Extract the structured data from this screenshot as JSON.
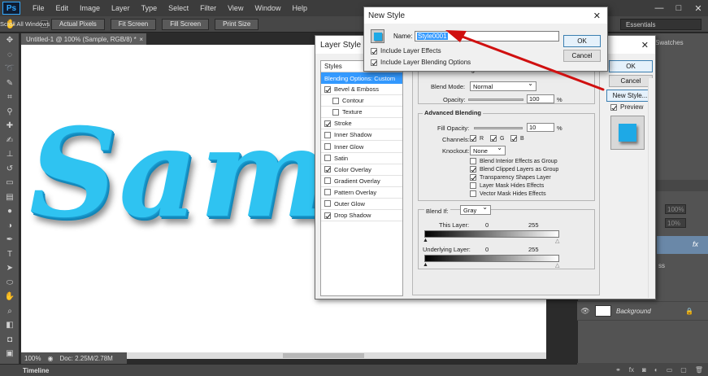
{
  "app": {
    "logo": "Ps"
  },
  "menu": [
    "File",
    "Edit",
    "Image",
    "Layer",
    "Type",
    "Select",
    "Filter",
    "View",
    "Window",
    "Help"
  ],
  "window_controls": {
    "minimize": "—",
    "maximize": "□",
    "close": "✕"
  },
  "options_bar": {
    "tool_icon": "hand-icon",
    "scroll_all_label": "Scroll All Windows",
    "buttons": [
      "Actual Pixels",
      "Fit Screen",
      "Fill Screen",
      "Print Size"
    ],
    "workspace": "Essentials"
  },
  "document": {
    "tab_title": "Untitled-1 @ 100% (Sample, RGB/8) *",
    "tab_close": "×",
    "canvas_text": "Sam",
    "text_color": "#2fc3f1"
  },
  "status": {
    "zoom": "100%",
    "doc_size": "Doc: 2.25M/2.78M"
  },
  "timeline": {
    "label": "Timeline"
  },
  "panels": {
    "swatches_tab": "Swatches",
    "opacity_pct": "100%",
    "fill_pct": "10%",
    "fx_label": "fx",
    "ss_text": "ss",
    "background_layer": "Background"
  },
  "layer_style": {
    "title": "Layer Style",
    "close": "✕",
    "styles_header": "Styles",
    "blending_item": "Blending Options: Custom",
    "items": [
      {
        "label": "Bevel & Emboss",
        "checked": true,
        "sub": false
      },
      {
        "label": "Contour",
        "checked": false,
        "sub": true
      },
      {
        "label": "Texture",
        "checked": false,
        "sub": true
      },
      {
        "label": "Stroke",
        "checked": true,
        "sub": false
      },
      {
        "label": "Inner Shadow",
        "checked": false,
        "sub": false
      },
      {
        "label": "Inner Glow",
        "checked": false,
        "sub": false
      },
      {
        "label": "Satin",
        "checked": false,
        "sub": false
      },
      {
        "label": "Color Overlay",
        "checked": true,
        "sub": false
      },
      {
        "label": "Gradient Overlay",
        "checked": false,
        "sub": false
      },
      {
        "label": "Pattern Overlay",
        "checked": false,
        "sub": false
      },
      {
        "label": "Outer Glow",
        "checked": false,
        "sub": false
      },
      {
        "label": "Drop Shadow",
        "checked": true,
        "sub": false
      }
    ],
    "general": {
      "title": "General Blending",
      "blend_mode_label": "Blend Mode:",
      "blend_mode": "Normal",
      "opacity_label": "Opacity:",
      "opacity": "100",
      "pct": "%"
    },
    "advanced": {
      "title": "Advanced Blending",
      "fill_opacity_label": "Fill Opacity:",
      "fill_opacity": "10",
      "pct": "%",
      "channels_label": "Channels:",
      "channels": [
        "R",
        "G",
        "B"
      ],
      "knockout_label": "Knockout:",
      "knockout": "None",
      "options": [
        {
          "label": "Blend Interior Effects as Group",
          "checked": false
        },
        {
          "label": "Blend Clipped Layers as Group",
          "checked": true
        },
        {
          "label": "Transparency Shapes Layer",
          "checked": true
        },
        {
          "label": "Layer Mask Hides Effects",
          "checked": false
        },
        {
          "label": "Vector Mask Hides Effects",
          "checked": false
        }
      ]
    },
    "blend_if": {
      "label": "Blend If:",
      "value": "Gray",
      "this_layer_label": "This Layer:",
      "underlying_label": "Underlying Layer:",
      "min": "0",
      "max": "255"
    },
    "buttons": {
      "ok": "OK",
      "cancel": "Cancel",
      "new_style": "New Style...",
      "preview": "Preview"
    }
  },
  "new_style": {
    "title": "New Style",
    "close": "✕",
    "name_label": "Name:",
    "name_value": "Style0001",
    "include_effects": "Include Layer Effects",
    "include_blending": "Include Layer Blending Options",
    "ok": "OK",
    "cancel": "Cancel"
  },
  "annotation": {
    "arrow_color": "#d01010"
  }
}
